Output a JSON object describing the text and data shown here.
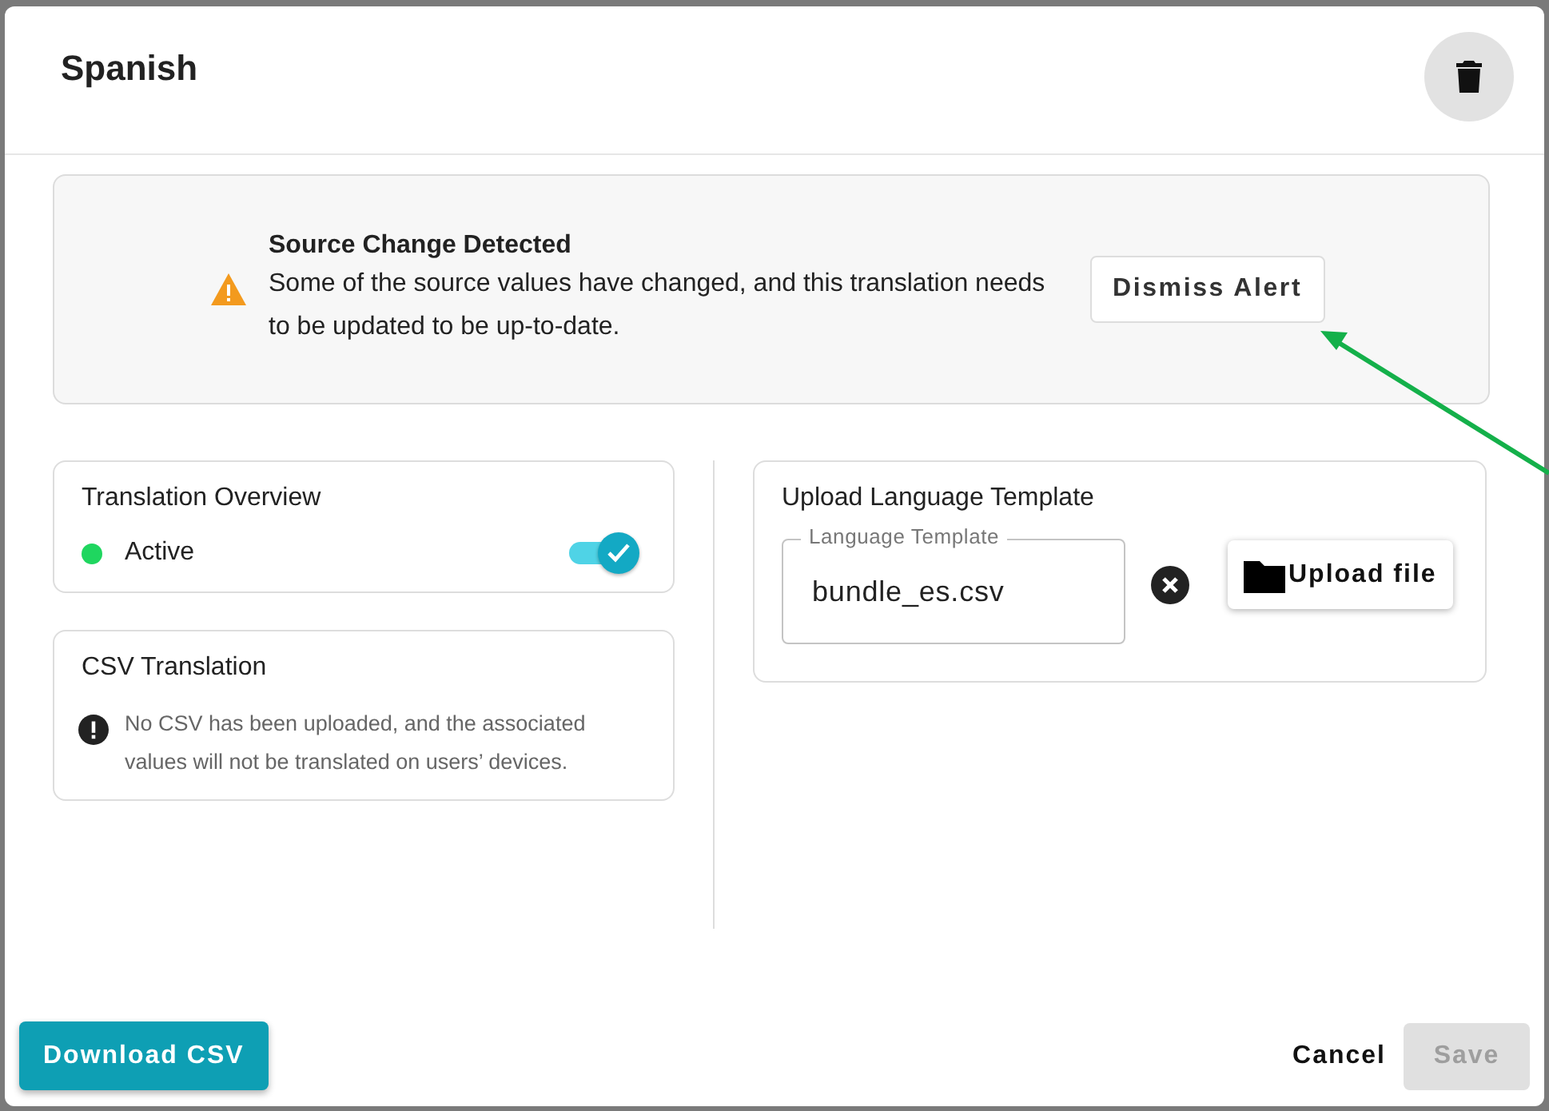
{
  "dialog": {
    "title": "Spanish"
  },
  "alert": {
    "title": "Source Change Detected",
    "message": "Some of the source values have changed, and this translation needs to be updated to be up-to-date.",
    "button": "Dismiss Alert"
  },
  "overview": {
    "title": "Translation Overview",
    "status": "Active",
    "on": true
  },
  "csv": {
    "title": "CSV Translation",
    "message": "No CSV has been uploaded, and the associated values will not be translated on users’ devices."
  },
  "upload": {
    "title": "Upload Language Template",
    "field_label": "Language Template",
    "value": "bundle_es.csv",
    "button": "Upload file"
  },
  "footer": {
    "download": "Download CSV",
    "cancel": "Cancel",
    "save": "Save",
    "save_disabled": true
  }
}
